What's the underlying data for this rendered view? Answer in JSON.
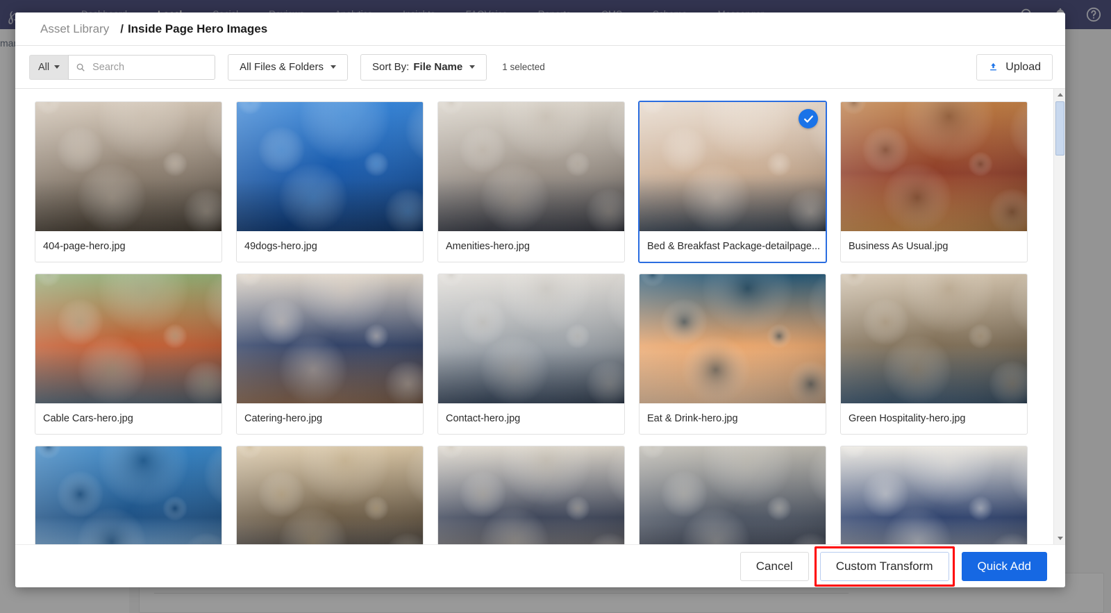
{
  "app": {
    "logo_glyph": "℘",
    "nav_items": [
      {
        "label": "Dashboard",
        "active": false
      },
      {
        "label": "Local",
        "active": true
      },
      {
        "label": "Social",
        "active": false
      },
      {
        "label": "Reviews",
        "active": false
      },
      {
        "label": "Analytics",
        "active": false
      },
      {
        "label": "Insights",
        "active": false
      },
      {
        "label": "FAQVoice",
        "active": false
      },
      {
        "label": "Reports",
        "active": false
      },
      {
        "label": "CMS",
        "active": false
      },
      {
        "label": "Schema",
        "active": false
      },
      {
        "label": "Messenger",
        "active": false
      }
    ],
    "nav_icons": [
      "search-icon",
      "bell-icon",
      "help-icon"
    ],
    "left_rail_text": "mar"
  },
  "modal": {
    "breadcrumb": {
      "root": "Asset Library",
      "separator": "/",
      "current": "Inside Page Hero Images"
    },
    "toolbar": {
      "filter_all_label": "All",
      "search_placeholder": "Search",
      "search_value": "",
      "files_folders_label": "All Files & Folders",
      "sort_prefix": "Sort By:",
      "sort_value": "File Name",
      "selected_count_label": "1 selected",
      "upload_label": "Upload"
    },
    "grid": {
      "items": [
        {
          "name": "404-page-hero.jpg",
          "selected": false,
          "image": "hotel-lobby-chandelier"
        },
        {
          "name": "49dogs-hero.jpg",
          "selected": false,
          "image": "blue-magazine-cover"
        },
        {
          "name": "Amenities-hero.jpg",
          "selected": false,
          "image": "lounge-seating"
        },
        {
          "name": "Bed & Breakfast Package-detailpage...",
          "selected": true,
          "image": "woman-breakfast-in-bed"
        },
        {
          "name": "Business As Usual.jpg",
          "selected": false,
          "image": "rooftop-networking-event"
        },
        {
          "name": "Cable Cars-hero.jpg",
          "selected": false,
          "image": "san-francisco-cable-car"
        },
        {
          "name": "Catering-hero.jpg",
          "selected": false,
          "image": "catering-buffet-guests"
        },
        {
          "name": "Contact-hero.jpg",
          "selected": false,
          "image": "hotel-front-desk"
        },
        {
          "name": "Eat & Drink-hero.jpg",
          "selected": false,
          "image": "cocktail-garnish"
        },
        {
          "name": "Green Hospitality-hero.jpg",
          "selected": false,
          "image": "lounge-armchairs"
        },
        {
          "name": "",
          "selected": false,
          "image": "glass-building-exterior"
        },
        {
          "name": "",
          "selected": false,
          "image": "boardroom-meeting-table"
        },
        {
          "name": "",
          "selected": false,
          "image": "hotel-lobby-sofas"
        },
        {
          "name": "",
          "selected": false,
          "image": "man-in-car"
        },
        {
          "name": "",
          "selected": false,
          "image": "dog-in-bed"
        }
      ]
    },
    "footer": {
      "cancel_label": "Cancel",
      "custom_transform_label": "Custom Transform",
      "quick_add_label": "Quick Add"
    }
  },
  "colors": {
    "nav_bg": "#1b1f5e",
    "accent_blue": "#1668e3",
    "selection_blue": "#2a6de0",
    "highlight_red": "#ff0000"
  }
}
